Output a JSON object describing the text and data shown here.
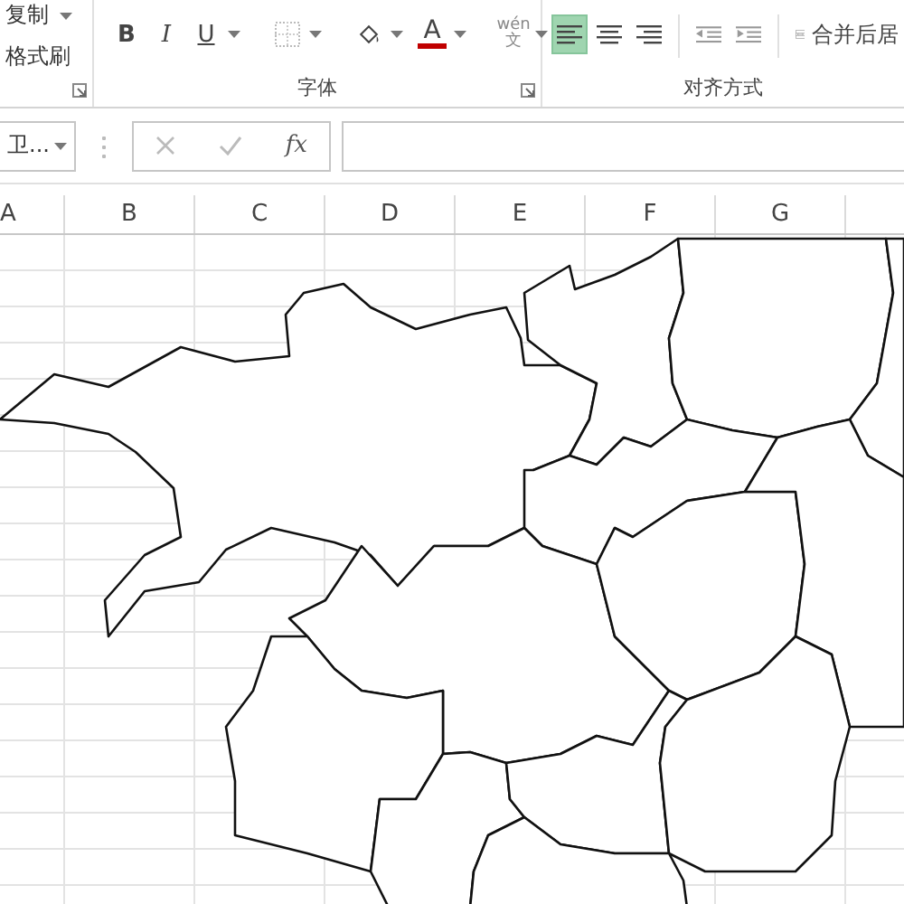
{
  "ribbon": {
    "groups": [
      {
        "kind": "clipboard",
        "items": [
          {
            "label": "复制"
          },
          {
            "label": "格式刷"
          }
        ]
      },
      {
        "kind": "font",
        "label": "字体",
        "buttons": [
          {
            "kind": "bold",
            "label": "B"
          },
          {
            "kind": "italic",
            "label": "I"
          },
          {
            "kind": "underline",
            "label": "U"
          },
          {
            "kind": "borders"
          },
          {
            "kind": "fill-color"
          },
          {
            "kind": "font-color",
            "label": "A"
          },
          {
            "kind": "phonetic",
            "label": "wén",
            "sub": "文"
          }
        ]
      },
      {
        "kind": "alignment",
        "label": "对齐方式",
        "buttons": [
          {
            "kind": "align-left",
            "selected": true
          },
          {
            "kind": "align-center",
            "selected": false
          },
          {
            "kind": "align-right",
            "selected": false
          },
          {
            "kind": "outdent"
          },
          {
            "kind": "indent"
          },
          {
            "kind": "merge",
            "label": "合并后居"
          }
        ]
      }
    ]
  },
  "formula_bar": {
    "name_box": "卫...",
    "function_label": "fx"
  },
  "sheet": {
    "columns": [
      "A",
      "B",
      "C",
      "D",
      "E",
      "F",
      "G"
    ]
  }
}
